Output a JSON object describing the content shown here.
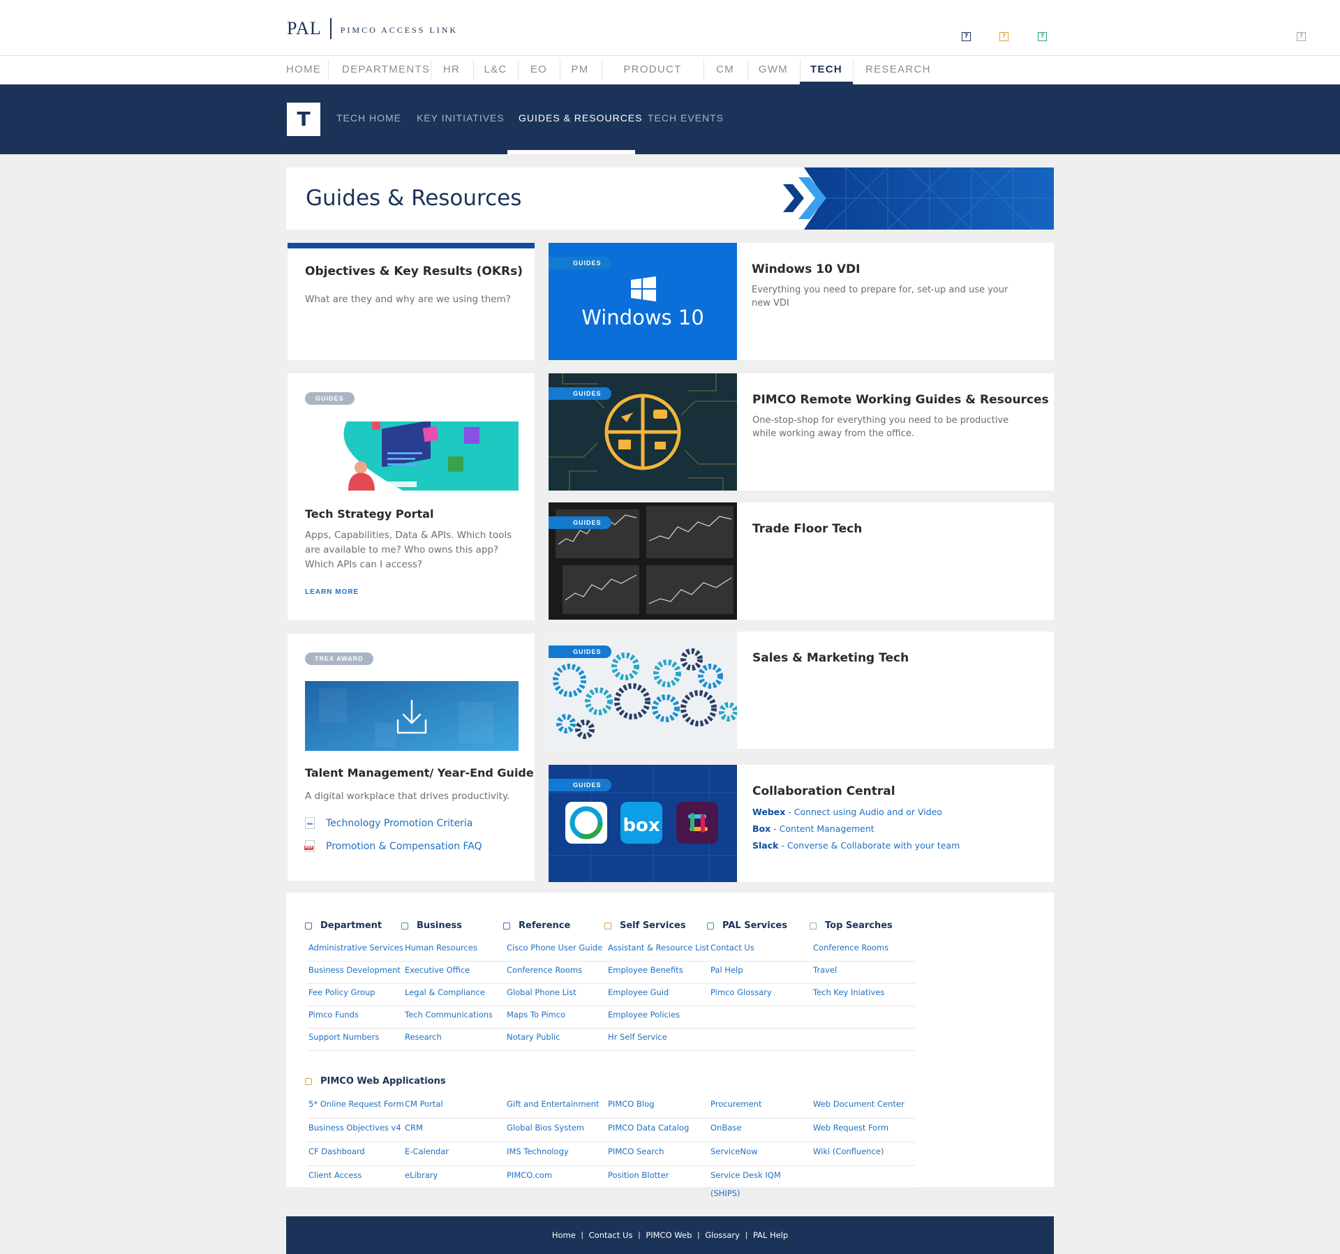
{
  "header": {
    "logo_main": "PAL",
    "logo_sub": "PIMCO ACCESS LINK",
    "icons": [
      {
        "name": "help-icon-navy",
        "glyph": "?",
        "color": "#1b3358"
      },
      {
        "name": "help-icon-orange",
        "glyph": "?",
        "color": "#d9a23b"
      },
      {
        "name": "help-icon-green",
        "glyph": "?",
        "color": "#2aa57a"
      },
      {
        "name": "help-icon-gray",
        "glyph": "?",
        "color": "#9aa6b5"
      }
    ]
  },
  "topnav": {
    "items": [
      "HOME",
      "DEPARTMENTS",
      "HR",
      "L&C",
      "EO",
      "PM",
      "PRODUCT INFO",
      "CM",
      "GWM",
      "TECH",
      "RESEARCH"
    ],
    "active": "TECH"
  },
  "subnav": {
    "badge": "T",
    "items": [
      "TECH HOME",
      "KEY INITIATIVES",
      "GUIDES & RESOURCES",
      "TECH EVENTS"
    ],
    "active": "GUIDES & RESOURCES"
  },
  "banner": {
    "title": "Guides & Resources"
  },
  "cards": {
    "okr": {
      "title": "Objectives & Key Results (OKRs)",
      "desc": "What are they and why are we using them?"
    },
    "tech_strategy": {
      "tag": "GUIDES",
      "title": "Tech Strategy Portal",
      "desc": "Apps, Capabilities, Data & APIs. Which tools are available to me? Who owns this app? Which APIs can I access?",
      "link": "LEARN MORE"
    },
    "talent": {
      "tag": "TREX AWARD",
      "title": "Talent Management/ Year-End Guide",
      "desc": "A digital workplace that drives productivity.",
      "links": [
        {
          "label": "Technology Promotion Criteria",
          "icon": "doc-icon"
        },
        {
          "label": "Promotion & Compensation FAQ",
          "icon": "pdf-icon",
          "icon_text": "PDF"
        }
      ]
    },
    "win10": {
      "tag": "GUIDES",
      "thumb_text": "Windows 10",
      "title": "Windows 10 VDI",
      "desc": "Everything you need to prepare for, set-up and use your new VDI"
    },
    "remote": {
      "tag": "GUIDES",
      "title": "PIMCO Remote Working Guides & Resources",
      "desc": "One-stop-shop for everything you need to be productive while working away from the office."
    },
    "trade": {
      "tag": "GUIDES",
      "title": "Trade Floor Tech"
    },
    "sales": {
      "tag": "GUIDES",
      "title": "Sales & Marketing Tech"
    },
    "collab": {
      "tag": "GUIDES",
      "title": "Collaboration Central",
      "box_text": "box",
      "lines": [
        {
          "name": "Webex",
          "text": " - Connect using Audio and or Video"
        },
        {
          "name": "Box",
          "text": " - Content Management"
        },
        {
          "name": "Slack",
          "text": " - Converse & Collaborate with your team"
        }
      ]
    }
  },
  "footer": {
    "columns": [
      {
        "head": "Department",
        "icon_color": "#3b6fb6",
        "links": [
          "Administrative Services",
          "Business Development",
          "Fee Policy Group",
          "Pimco Funds",
          "Support Numbers"
        ]
      },
      {
        "head": "Business",
        "icon_color": "#3a9d6a",
        "links": [
          "Human Resources",
          "Executive Office",
          "Legal & Compliance",
          "Tech Communications",
          "Research"
        ]
      },
      {
        "head": "Reference",
        "icon_color": "#3b6fb6",
        "links": [
          "Cisco Phone User Guide",
          "Conference Rooms",
          "Global Phone List",
          "Maps To Pimco",
          "Notary Public"
        ]
      },
      {
        "head": "Self Services",
        "icon_color": "#d9a23b",
        "links": [
          "Assistant & Resource List",
          "Employee Benefits",
          "Employee Guid",
          "Employee Policies",
          "Hr Self Service"
        ]
      },
      {
        "head": "PAL Services",
        "icon_color": "#2aa57a",
        "links": [
          "Contact Us",
          "Pal Help",
          "Pimco Glossary"
        ]
      },
      {
        "head": "Top Searches",
        "icon_color": "#9aa6b5",
        "links": [
          "Conference Rooms",
          "Travel",
          "Tech Key Iniatives"
        ]
      }
    ],
    "web_apps": {
      "head": "PIMCO Web Applications",
      "icon_color": "#d9a23b",
      "columns": [
        [
          "5* Online Request Form",
          "Business Objectives v4",
          "CF Dashboard",
          "Client Access"
        ],
        [
          "CM Portal",
          "CRM",
          "E-Calendar",
          "eLibrary"
        ],
        [
          "Gift and Entertainment",
          "Global Bios System",
          "IMS Technology",
          "PIMCO.com"
        ],
        [
          "PIMCO Blog",
          "PIMCO Data Catalog",
          "PIMCO Search",
          "Position Blotter"
        ],
        [
          "Procurement",
          "OnBase",
          "ServiceNow",
          "Service Desk IQM (SHIPS)"
        ],
        [
          "Web Document Center",
          "Web Request Form",
          "Wiki (Confluence)",
          ""
        ]
      ]
    },
    "bar": [
      "Home",
      "Contact Us",
      "PIMCO Web",
      "Glossary",
      "PAL Help"
    ]
  },
  "colors": {
    "navy": "#1b3358",
    "accent_blue": "#1479d0",
    "link": "#1f6fc2"
  }
}
